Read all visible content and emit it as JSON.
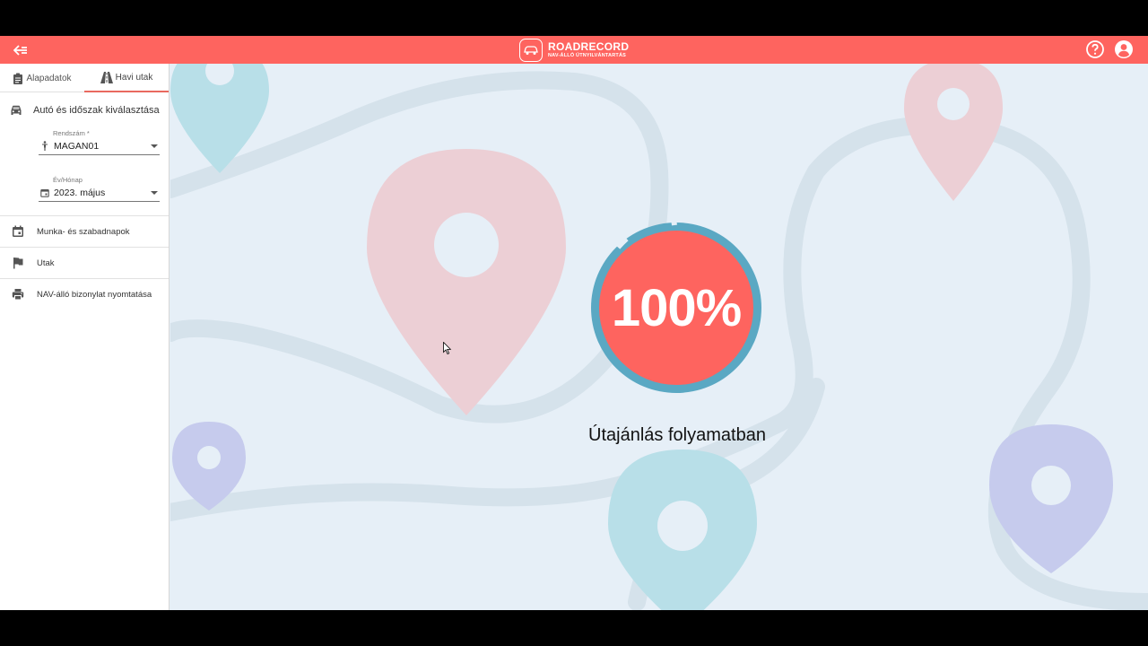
{
  "header": {
    "logo_title": "ROADRECORD",
    "logo_subtitle": "NAV-ÁLLÓ ÚTNYILVÁNTARTÁS",
    "back_icon": "arrow-back-icon",
    "help_icon": "help-circle-icon",
    "account_icon": "account-circle-icon"
  },
  "sidebar": {
    "tabs": [
      {
        "label": "Alapadatok",
        "icon": "clipboard-icon",
        "active": false
      },
      {
        "label": "Havi utak",
        "icon": "road-icon",
        "active": true
      }
    ],
    "section_title": "Autó és időszak kiválasztása",
    "plate": {
      "label": "Rendszám *",
      "value": "MAGAN01"
    },
    "period": {
      "label": "Év/Hónap",
      "value": "2023. május"
    },
    "menu": [
      {
        "label": "Munka- és szabadnapok",
        "icon": "calendar-icon"
      },
      {
        "label": "Utak",
        "icon": "flag-icon"
      },
      {
        "label": "NAV-álló bizonylat nyomtatása",
        "icon": "printer-icon"
      }
    ]
  },
  "main": {
    "progress": 100,
    "progress_label": "100%",
    "status": "Útajánlás folyamatban"
  },
  "colors": {
    "brand": "#fe645f",
    "progress_ring": "#5aa8c3",
    "background": "#e6eff7"
  }
}
